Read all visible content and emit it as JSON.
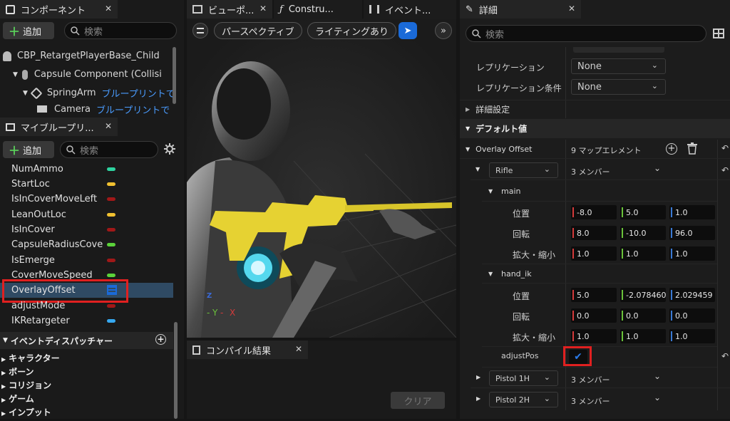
{
  "components": {
    "tab_title": "コンポーネント",
    "add_label": "追加",
    "search_placeholder": "検索",
    "tree": [
      {
        "label": "CBP_RetargetPlayerBase_Child"
      },
      {
        "label": "Capsule Component (Collisi"
      },
      {
        "label": "SpringArm",
        "link": "ブループリントで"
      },
      {
        "label": "Camera",
        "link": "ブループリントで"
      }
    ]
  },
  "my_blueprint": {
    "tab_title": "マイブループリ...",
    "add_label": "追加",
    "search_placeholder": "検索",
    "variables": [
      {
        "name": "NumAmmo",
        "color": "#2ed3a0"
      },
      {
        "name": "StartLoc",
        "color": "#f0c030"
      },
      {
        "name": "IsInCoverMoveLeft",
        "color": "#a01818"
      },
      {
        "name": "LeanOutLoc",
        "color": "#f0c030"
      },
      {
        "name": "IsInCover",
        "color": "#a01818"
      },
      {
        "name": "CapsuleRadiusCove",
        "color": "#5bd23a"
      },
      {
        "name": "IsEmerge",
        "color": "#a01818"
      },
      {
        "name": "CoverMoveSpeed",
        "color": "#5bd23a"
      },
      {
        "name": "OverlayOffset",
        "color": "#1a6ad8"
      },
      {
        "name": "adjustMode",
        "color": "#a01818"
      },
      {
        "name": "IKRetargeter",
        "color": "#36a8f0"
      }
    ],
    "dispatcher_header": "イベントディスパッチャー",
    "categories": [
      "キャラクター",
      "ボーン",
      "コリジョン",
      "ゲーム",
      "インプット"
    ]
  },
  "viewport": {
    "tabs": [
      "ビューポ...",
      "Constru...",
      "イベント..."
    ],
    "perspective_label": "パースペクティブ",
    "lighting_label": "ライティングあり",
    "axis_y": "Y",
    "axis_x": "X",
    "axis_z": "Z"
  },
  "compile": {
    "tab_title": "コンパイル結果",
    "clear_label": "クリア"
  },
  "details": {
    "tab_title": "詳細",
    "search_placeholder": "検索",
    "replication_label": "レプリケーション",
    "replication_value": "None",
    "replication_cond_label": "レプリケーション条件",
    "replication_cond_value": "None",
    "advanced_label": "詳細設定",
    "defaults_label": "デフォルト値",
    "overlay_label": "Overlay Offset",
    "overlay_count": "9 マップエレメント",
    "rifle_key": "Rifle",
    "rifle_members": "3 メンバー",
    "main_label": "main",
    "hand_ik_label": "hand_ik",
    "location_label": "位置",
    "rotation_label": "回転",
    "scale_label": "拡大・縮小",
    "main": {
      "location": [
        "-8.0",
        "5.0",
        "1.0"
      ],
      "rotation": [
        "8.0",
        "-10.0",
        "96.0"
      ],
      "scale": [
        "1.0",
        "1.0",
        "1.0"
      ]
    },
    "hand_ik": {
      "location": [
        "5.0",
        "-2.078460",
        "2.029459"
      ],
      "rotation": [
        "0.0",
        "0.0",
        "0.0"
      ],
      "scale": [
        "1.0",
        "1.0",
        "1.0"
      ]
    },
    "adjust_label": "adjustPos",
    "pistol1_key": "Pistol 1H",
    "pistol1_members": "3 メンバー",
    "pistol2_key": "Pistol 2H",
    "pistol2_members": "3 メンバー"
  },
  "colors": {
    "accent_blue": "#1a6ad8",
    "highlight_red": "#e02020",
    "gun_yellow": "#e6d232"
  }
}
